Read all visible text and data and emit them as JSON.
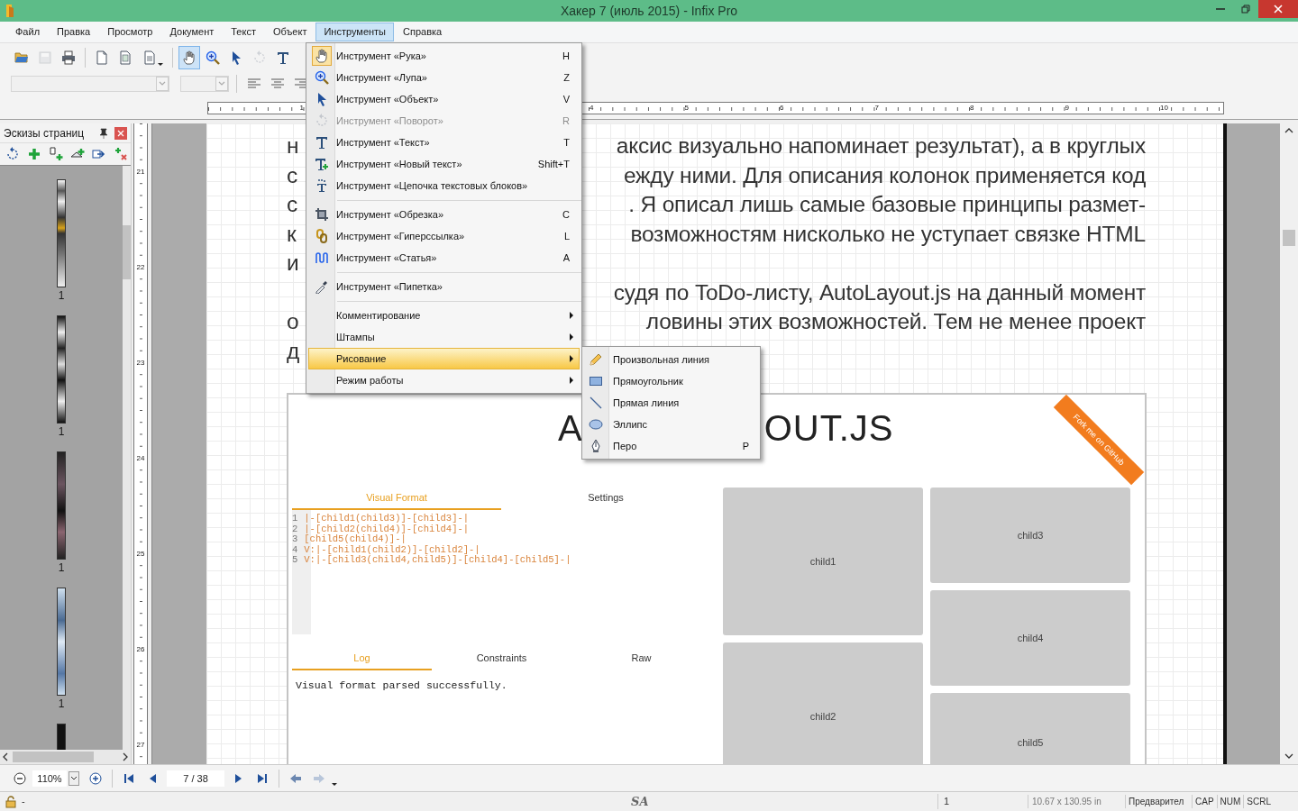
{
  "window": {
    "title": "Хакер 7 (июль 2015) - Infix Pro"
  },
  "menu_bar": [
    {
      "label": "Файл",
      "selected": false
    },
    {
      "label": "Правка",
      "selected": false
    },
    {
      "label": "Просмотр",
      "selected": false
    },
    {
      "label": "Документ",
      "selected": false
    },
    {
      "label": "Текст",
      "selected": false
    },
    {
      "label": "Объект",
      "selected": false
    },
    {
      "label": "Инструменты",
      "selected": true
    },
    {
      "label": "Справка",
      "selected": false
    }
  ],
  "toolbar": [
    {
      "selected": false,
      "disabled": false
    },
    {
      "selected": false,
      "disabled": true
    },
    {
      "selected": false,
      "disabled": false
    },
    {
      "selected": false,
      "disabled": false
    },
    {
      "selected": false,
      "disabled": false
    },
    {
      "selected": false,
      "disabled": false
    },
    {
      "selected": true,
      "disabled": false
    },
    {
      "selected": false,
      "disabled": false
    },
    {
      "selected": false,
      "disabled": false
    },
    {
      "selected": false,
      "disabled": true
    },
    {
      "selected": false,
      "disabled": false
    }
  ],
  "ruler": {
    "left_labels": [
      "1"
    ],
    "right_labels": [
      "4",
      "5",
      "6",
      "7",
      "8",
      "9",
      "10"
    ]
  },
  "vertical_ruler": [
    "21",
    "22",
    "23",
    "24",
    "25",
    "26",
    "27"
  ],
  "thumbnails_panel": {
    "title": "Эскизы страниц",
    "pages": [
      {
        "label": "1"
      },
      {
        "label": "1"
      },
      {
        "label": "1"
      },
      {
        "label": "1"
      }
    ]
  },
  "document": {
    "lines": [
      {
        "left": "н",
        "right": "аксис визуально напоминает результат), а в круглых"
      },
      {
        "left": "с",
        "right": "ежду ними. Для описания колонок применяется код"
      },
      {
        "left": "с",
        "right": ". Я описал лишь самые базовые принципы размет-"
      },
      {
        "left": "к",
        "right": "возможностям нисколько не уступает связке HTML"
      },
      {
        "left": "и"
      },
      {
        "right": "судя по ToDo-листу, AutoLayout.js на данный момент"
      },
      {
        "left": "о",
        "right": "ловины этих возможностей. Тем не менее проект"
      },
      {
        "left": "д"
      }
    ],
    "embedded_screenshot": {
      "title_left": "A",
      "title_right": "OUT.JS",
      "ribbon": "Fork me on GitHub",
      "editor_tabs": [
        {
          "label": "Visual Format",
          "selected": true
        },
        {
          "label": "Settings",
          "selected": false
        }
      ],
      "code_lines": [
        {
          "number": "1",
          "code": "|-[child1(child3)]-[child3]-|"
        },
        {
          "number": "2",
          "code": "|-[child2(child4)]-[child4]-|"
        },
        {
          "number": "3",
          "code": "[child5(child4)]-|"
        },
        {
          "number": "4",
          "code": "V:|-[child1(child2)]-[child2]-|"
        },
        {
          "number": "5",
          "code": "V:|-[child3(child4,child5)]-[child4]-[child5]-|"
        }
      ],
      "output_tabs": [
        {
          "label": "Log",
          "selected": true
        },
        {
          "label": "Constraints",
          "selected": false
        },
        {
          "label": "Raw",
          "selected": false
        }
      ],
      "log": "Visual format parsed successfully.",
      "views": [
        "child1",
        "child2",
        "child3",
        "child4",
        "child5"
      ]
    }
  },
  "menu": {
    "groups": [
      [
        {
          "label": "Инструмент «Рука»",
          "shortcut": "H",
          "checked": true,
          "disabled": false,
          "selected": false
        },
        {
          "label": "Инструмент «Лупа»",
          "shortcut": "Z",
          "checked": false,
          "disabled": false,
          "selected": false
        },
        {
          "label": "Инструмент «Объект»",
          "shortcut": "V",
          "checked": false,
          "disabled": false,
          "selected": false
        },
        {
          "label": "Инструмент «Поворот»",
          "shortcut": "R",
          "checked": false,
          "disabled": true,
          "selected": false
        },
        {
          "label": "Инструмент «Текст»",
          "shortcut": "T",
          "checked": false,
          "disabled": false,
          "selected": false
        },
        {
          "label": "Инструмент «Новый текст»",
          "shortcut": "Shift+T",
          "checked": false,
          "disabled": false,
          "selected": false
        },
        {
          "label": "Инструмент «Цепочка текстовых блоков»",
          "checked": false,
          "disabled": false,
          "selected": false
        }
      ],
      [
        {
          "label": "Инструмент «Обрезка»",
          "shortcut": "C",
          "checked": false,
          "disabled": false,
          "selected": false
        },
        {
          "label": "Инструмент «Гиперссылка»",
          "shortcut": "L",
          "checked": false,
          "disabled": false,
          "selected": false
        },
        {
          "label": "Инструмент «Статья»",
          "shortcut": "A",
          "checked": false,
          "disabled": false,
          "selected": false
        }
      ],
      [
        {
          "label": "Инструмент «Пипетка»",
          "checked": false,
          "disabled": false,
          "selected": false
        }
      ],
      [
        {
          "label": "Комментирование",
          "submenu": true,
          "disabled": false,
          "selected": false
        },
        {
          "label": "Штампы",
          "submenu": true,
          "disabled": false,
          "selected": false
        },
        {
          "label": "Рисование",
          "submenu": true,
          "disabled": false,
          "selected": true
        },
        {
          "label": "Режим работы",
          "submenu": true,
          "disabled": false,
          "selected": false
        }
      ]
    ]
  },
  "submenu": [
    {
      "label": "Произвольная линия"
    },
    {
      "label": "Прямоугольник"
    },
    {
      "label": "Прямая линия"
    },
    {
      "label": "Эллипс"
    },
    {
      "label": "Перо",
      "shortcut": "P"
    }
  ],
  "navigation": {
    "zoom": "110%",
    "page": "7 / 38"
  },
  "status_bar": {
    "lock": "-",
    "logo": "SA",
    "page": "1",
    "size": "10.67 x 130.95 in",
    "mode": "Предварител",
    "indicators": [
      "CAP",
      "NUM",
      "SCRL"
    ]
  }
}
